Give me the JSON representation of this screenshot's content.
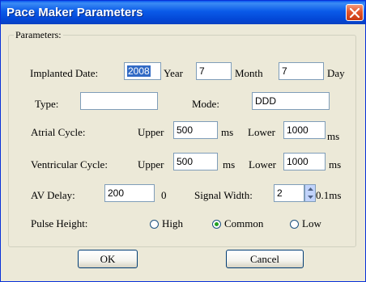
{
  "window": {
    "title": "Pace Maker Parameters"
  },
  "group": {
    "legend": "Parameters:"
  },
  "implanted": {
    "label": "Implanted Date:",
    "year_value": "2008",
    "year_label": "Year",
    "month_value": "7",
    "month_label": "Month",
    "day_value": "7",
    "day_label": "Day"
  },
  "type": {
    "label": "Type:",
    "value": ""
  },
  "mode": {
    "label": "Mode:",
    "value": "DDD"
  },
  "atrial": {
    "label": "Atrial Cycle:",
    "upper_label": "Upper",
    "upper_value": "500",
    "upper_unit": "ms",
    "lower_label": "Lower",
    "lower_value": "1000",
    "lower_unit": "ms"
  },
  "ventricular": {
    "label": "Ventricular Cycle:",
    "upper_label": "Upper",
    "upper_value": "500",
    "upper_unit": "ms",
    "lower_label": "Lower",
    "lower_value": "1000",
    "lower_unit": "ms"
  },
  "av_delay": {
    "label": "AV Delay:",
    "value": "200",
    "unit": "0"
  },
  "signal_width": {
    "label": "Signal Width:",
    "value": "2",
    "unit": "0.1ms"
  },
  "pulse_height": {
    "label": "Pulse Height:",
    "options": [
      "High",
      "Common",
      "Low"
    ],
    "selected": "Common"
  },
  "buttons": {
    "ok": "OK",
    "cancel": "Cancel"
  }
}
